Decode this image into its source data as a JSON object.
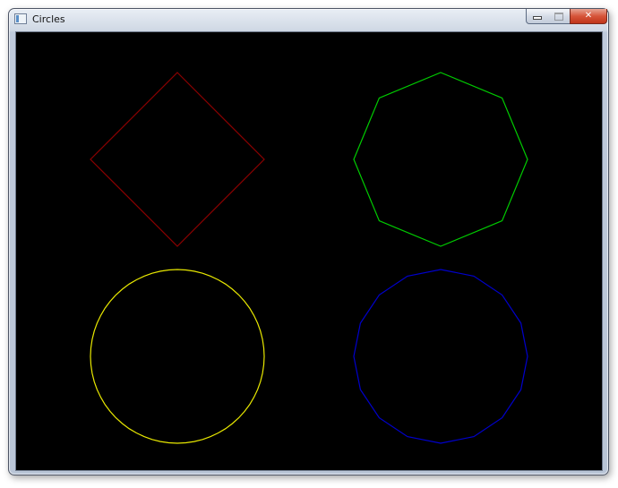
{
  "window": {
    "title": "Circles",
    "icon": "app-window-icon",
    "controls": {
      "minimize_icon": "minimize-icon",
      "maximize_icon": "maximize-icon",
      "close_label": "✕"
    }
  },
  "canvas": {
    "background": "#000000",
    "shapes": [
      {
        "name": "shape-red-4-sided",
        "sides": 4,
        "color": "#8b0000"
      },
      {
        "name": "shape-green-8-sided",
        "sides": 8,
        "color": "#00cc00"
      },
      {
        "name": "shape-yellow-circle",
        "sides": 64,
        "color": "#e8e800"
      },
      {
        "name": "shape-blue-16-sided",
        "sides": 16,
        "color": "#0000cc"
      }
    ]
  }
}
